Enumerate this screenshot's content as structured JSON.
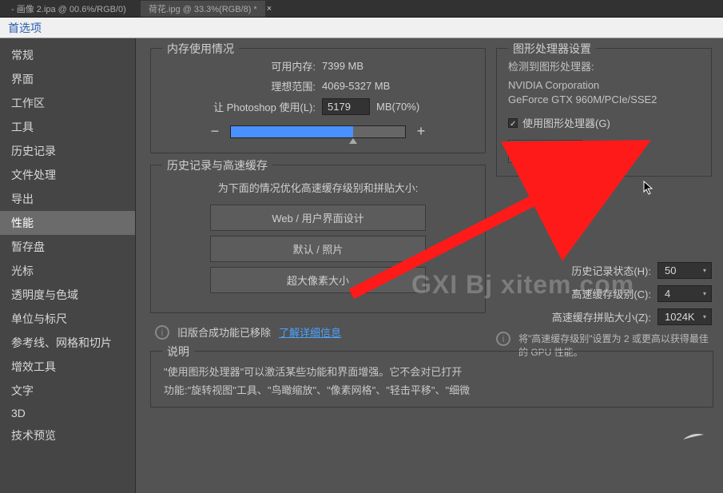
{
  "tabs": {
    "tab1": "- 画像 2.ipa @ 00.6%/RGB/0)",
    "tab2": "荷花.ipg @ 33.3%(RGB/8) *"
  },
  "title": "首选项",
  "sidebar": {
    "items": [
      "常规",
      "界面",
      "工作区",
      "工具",
      "历史记录",
      "文件处理",
      "导出",
      "性能",
      "暂存盘",
      "光标",
      "透明度与色域",
      "单位与标尺",
      "参考线、网格和切片",
      "增效工具",
      "文字",
      "3D",
      "技术预览"
    ],
    "selected_index": 7
  },
  "memory": {
    "legend": "内存使用情况",
    "avail_label": "可用内存:",
    "avail_value": "7399 MB",
    "ideal_label": "理想范围:",
    "ideal_value": "4069-5327 MB",
    "ps_use_label": "让 Photoshop 使用(L):",
    "ps_use_value": "5179",
    "ps_use_suffix": "MB(70%)"
  },
  "gpu": {
    "legend": "图形处理器设置",
    "detected_label": "检测到图形处理器:",
    "vendor": "NVIDIA Corporation",
    "device": "GeForce GTX 960M/PCIe/SSE2",
    "use_gpu_label": "使用图形处理器(G)",
    "advanced_btn": "高级设置..."
  },
  "history": {
    "legend": "历史记录与高速缓存",
    "desc": "为下面的情况优化高速缓存级别和拼贴大小:",
    "btn_web": "Web / 用户界面设计",
    "btn_default": "默认 / 照片",
    "btn_huge": "超大像素大小",
    "states_label": "历史记录状态(H):",
    "states_value": "50",
    "cache_levels_label": "高速缓存级别(C):",
    "cache_levels_value": "4",
    "tile_label": "高速缓存拼贴大小(Z):",
    "tile_value": "1024K",
    "gpu_tip": "将\"高速缓存级别\"设置为 2 或更高以获得最佳的 GPU 性能。"
  },
  "legacy": {
    "removed": "旧版合成功能已移除",
    "learn_more": "了解详细信息"
  },
  "explain": {
    "legend": "说明",
    "line1": "\"使用图形处理器\"可以激活某些功能和界面增强。它不会对已打开",
    "line2": "功能:\"旋转视图\"工具、\"鸟瞰缩放\"、\"像素网格\"、\"轻击平移\"、\"细微"
  },
  "watermark": "GXI Bj xitem.com"
}
